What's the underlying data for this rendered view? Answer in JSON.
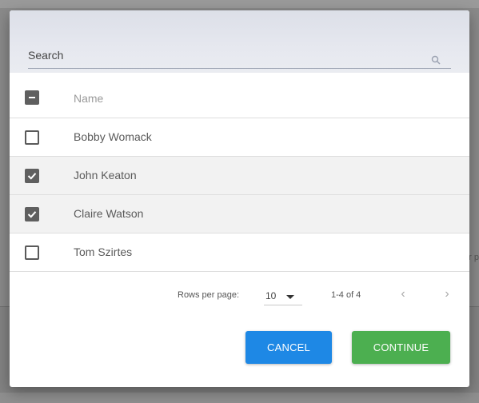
{
  "background": {
    "partial_text": "r p"
  },
  "search": {
    "label": "Search",
    "icon": "search-icon"
  },
  "table": {
    "header": {
      "name": "Name",
      "select_all_state": "indeterminate"
    },
    "rows": [
      {
        "name": "Bobby Womack",
        "checked": false
      },
      {
        "name": "John Keaton",
        "checked": true
      },
      {
        "name": "Claire Watson",
        "checked": true
      },
      {
        "name": "Tom Szirtes",
        "checked": false
      }
    ]
  },
  "pagination": {
    "rows_per_page_label": "Rows per page:",
    "rows_per_page_value": "10",
    "range_label": "1-4 of 4",
    "prev_icon": "chevron-left-icon",
    "next_icon": "chevron-right-icon"
  },
  "actions": {
    "cancel_label": "CANCEL",
    "continue_label": "CONTINUE"
  },
  "colors": {
    "cancel": "#1e88e5",
    "continue": "#4caf50",
    "selected_row": "#f2f2f2"
  }
}
